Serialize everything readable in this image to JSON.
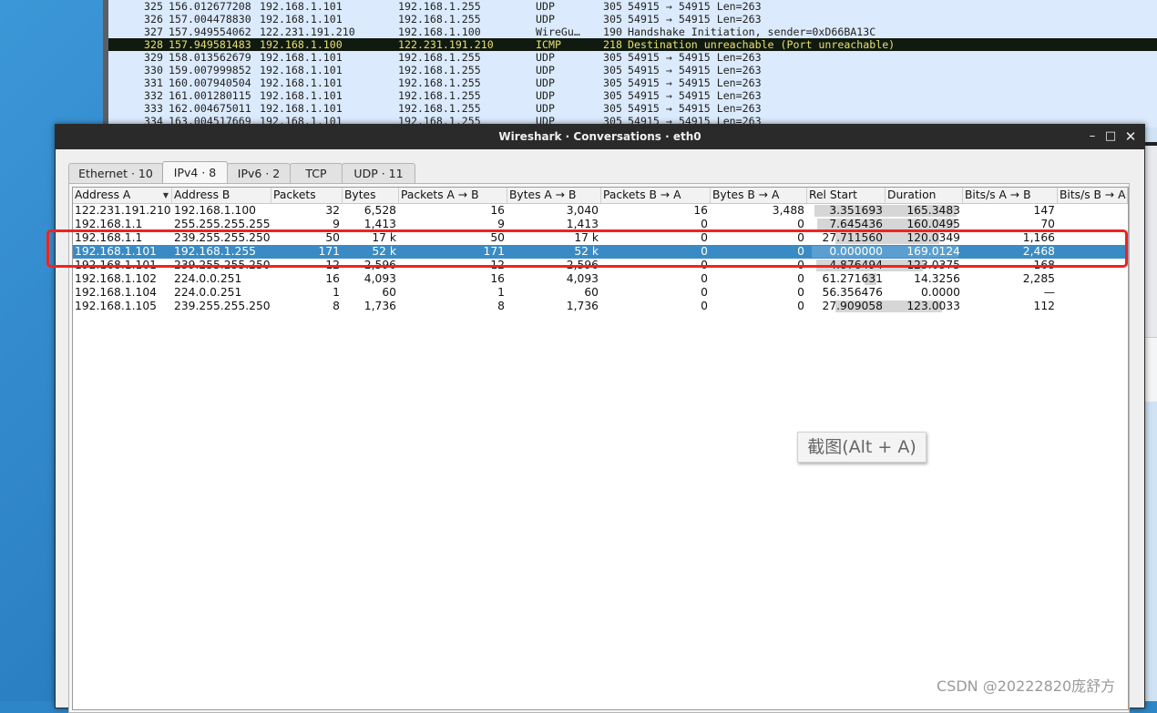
{
  "packet_list": {
    "rows": [
      {
        "no": "325",
        "time": "156.012677208",
        "src": "192.168.1.101",
        "dst": "192.168.1.255",
        "proto": "UDP",
        "len": "305",
        "info": "54915 → 54915 Len=263",
        "selected": false
      },
      {
        "no": "326",
        "time": "157.004478830",
        "src": "192.168.1.101",
        "dst": "192.168.1.255",
        "proto": "UDP",
        "len": "305",
        "info": "54915 → 54915 Len=263",
        "selected": false
      },
      {
        "no": "327",
        "time": "157.949554062",
        "src": "122.231.191.210",
        "dst": "192.168.1.100",
        "proto": "WireGu…",
        "len": "190",
        "info": "Handshake Initiation, sender=0xD66BA13C",
        "selected": false
      },
      {
        "no": "328",
        "time": "157.949581483",
        "src": "192.168.1.100",
        "dst": "122.231.191.210",
        "proto": "ICMP",
        "len": "218",
        "info": "Destination unreachable (Port unreachable)",
        "selected": true
      },
      {
        "no": "329",
        "time": "158.013562679",
        "src": "192.168.1.101",
        "dst": "192.168.1.255",
        "proto": "UDP",
        "len": "305",
        "info": "54915 → 54915 Len=263",
        "selected": false
      },
      {
        "no": "330",
        "time": "159.007999852",
        "src": "192.168.1.101",
        "dst": "192.168.1.255",
        "proto": "UDP",
        "len": "305",
        "info": "54915 → 54915 Len=263",
        "selected": false
      },
      {
        "no": "331",
        "time": "160.007940504",
        "src": "192.168.1.101",
        "dst": "192.168.1.255",
        "proto": "UDP",
        "len": "305",
        "info": "54915 → 54915 Len=263",
        "selected": false
      },
      {
        "no": "332",
        "time": "161.001280115",
        "src": "192.168.1.101",
        "dst": "192.168.1.255",
        "proto": "UDP",
        "len": "305",
        "info": "54915 → 54915 Len=263",
        "selected": false
      },
      {
        "no": "333",
        "time": "162.004675011",
        "src": "192.168.1.101",
        "dst": "192.168.1.255",
        "proto": "UDP",
        "len": "305",
        "info": "54915 → 54915 Len=263",
        "selected": false
      },
      {
        "no": "334",
        "time": "163.004517669",
        "src": "192.168.1.101",
        "dst": "192.168.1.255",
        "proto": "UDP",
        "len": "305",
        "info": "54915 → 54915 Len=263",
        "selected": false
      }
    ]
  },
  "dialog": {
    "title": "Wireshark · Conversations · eth0",
    "minimize_icon": "minimize-icon",
    "maximize_icon": "maximize-icon",
    "close_icon": "close-icon"
  },
  "tabs": [
    {
      "label": "Ethernet · 10",
      "active": false
    },
    {
      "label": "IPv4 · 8",
      "active": true
    },
    {
      "label": "IPv6 · 2",
      "active": false
    },
    {
      "label": "TCP",
      "active": false
    },
    {
      "label": "UDP · 11",
      "active": false
    }
  ],
  "table": {
    "columns": [
      "Address A",
      "Address B",
      "Packets",
      "Bytes",
      "Packets A → B",
      "Bytes A → B",
      "Packets B → A",
      "Bytes B → A",
      "Rel Start",
      "Duration",
      "Bits/s A → B",
      "Bits/s B → A"
    ],
    "sorted_column": "Address A",
    "rows": [
      {
        "addr_a": "122.231.191.210",
        "addr_b": "192.168.1.100",
        "packets": "32",
        "bytes": "6,528",
        "pkts_ab": "16",
        "bytes_ab": "3,040",
        "pkts_ba": "16",
        "bytes_ba": "3,488",
        "rel_start": "3.351693",
        "duration": "165.3483",
        "bps_ab": "147",
        "bps_ba": "",
        "selected": false,
        "start_frac": 0.02,
        "dur_frac": 0.97
      },
      {
        "addr_a": "192.168.1.1",
        "addr_b": "255.255.255.255",
        "packets": "9",
        "bytes": "1,413",
        "pkts_ab": "9",
        "bytes_ab": "1,413",
        "pkts_ba": "0",
        "bytes_ba": "0",
        "rel_start": "7.645436",
        "duration": "160.0495",
        "bps_ab": "70",
        "bps_ba": "",
        "selected": false,
        "start_frac": 0.04,
        "dur_frac": 0.94
      },
      {
        "addr_a": "192.168.1.1",
        "addr_b": "239.255.255.250",
        "packets": "50",
        "bytes": "17 k",
        "pkts_ab": "50",
        "bytes_ab": "17 k",
        "pkts_ba": "0",
        "bytes_ba": "0",
        "rel_start": "27.711560",
        "duration": "120.0349",
        "bps_ab": "1,166",
        "bps_ba": "",
        "selected": false,
        "start_frac": 0.16,
        "dur_frac": 0.71
      },
      {
        "addr_a": "192.168.1.101",
        "addr_b": "192.168.1.255",
        "packets": "171",
        "bytes": "52 k",
        "pkts_ab": "171",
        "bytes_ab": "52 k",
        "pkts_ba": "0",
        "bytes_ba": "0",
        "rel_start": "0.000000",
        "duration": "169.0124",
        "bps_ab": "2,468",
        "bps_ba": "",
        "selected": true,
        "start_frac": 0.0,
        "dur_frac": 1.0
      },
      {
        "addr_a": "192.168.1.101",
        "addr_b": "239.255.255.250",
        "packets": "12",
        "bytes": "2,596",
        "pkts_ab": "12",
        "bytes_ab": "2,596",
        "pkts_ba": "0",
        "bytes_ba": "0",
        "rel_start": "4.876494",
        "duration": "123.0375",
        "bps_ab": "168",
        "bps_ba": "",
        "selected": false,
        "start_frac": 0.03,
        "dur_frac": 0.73
      },
      {
        "addr_a": "192.168.1.102",
        "addr_b": "224.0.0.251",
        "packets": "16",
        "bytes": "4,093",
        "pkts_ab": "16",
        "bytes_ab": "4,093",
        "pkts_ba": "0",
        "bytes_ba": "0",
        "rel_start": "61.271631",
        "duration": "14.3256",
        "bps_ab": "2,285",
        "bps_ba": "",
        "selected": false,
        "start_frac": 0.36,
        "dur_frac": 0.08
      },
      {
        "addr_a": "192.168.1.104",
        "addr_b": "224.0.0.251",
        "packets": "1",
        "bytes": "60",
        "pkts_ab": "1",
        "bytes_ab": "60",
        "pkts_ba": "0",
        "bytes_ba": "0",
        "rel_start": "56.356476",
        "duration": "0.0000",
        "bps_ab": "—",
        "bps_ba": "",
        "selected": false,
        "start_frac": 0.33,
        "dur_frac": 0.0
      },
      {
        "addr_a": "192.168.1.105",
        "addr_b": "239.255.255.250",
        "packets": "8",
        "bytes": "1,736",
        "pkts_ab": "8",
        "bytes_ab": "1,736",
        "pkts_ba": "0",
        "bytes_ba": "0",
        "rel_start": "27.909058",
        "duration": "123.0033",
        "bps_ab": "112",
        "bps_ba": "",
        "selected": false,
        "start_frac": 0.16,
        "dur_frac": 0.73
      }
    ]
  },
  "overlay": {
    "screenshot_tip": "截图(Alt + A)",
    "watermark": "CSDN @20222820庞舒方",
    "highlight_color": "#f0231f"
  },
  "colors": {
    "selected_row": "#3a8bc5",
    "selected_packet_bg": "#111a10",
    "selected_packet_fg": "#e6e06b",
    "packet_list_bg": "#dbeafc"
  }
}
